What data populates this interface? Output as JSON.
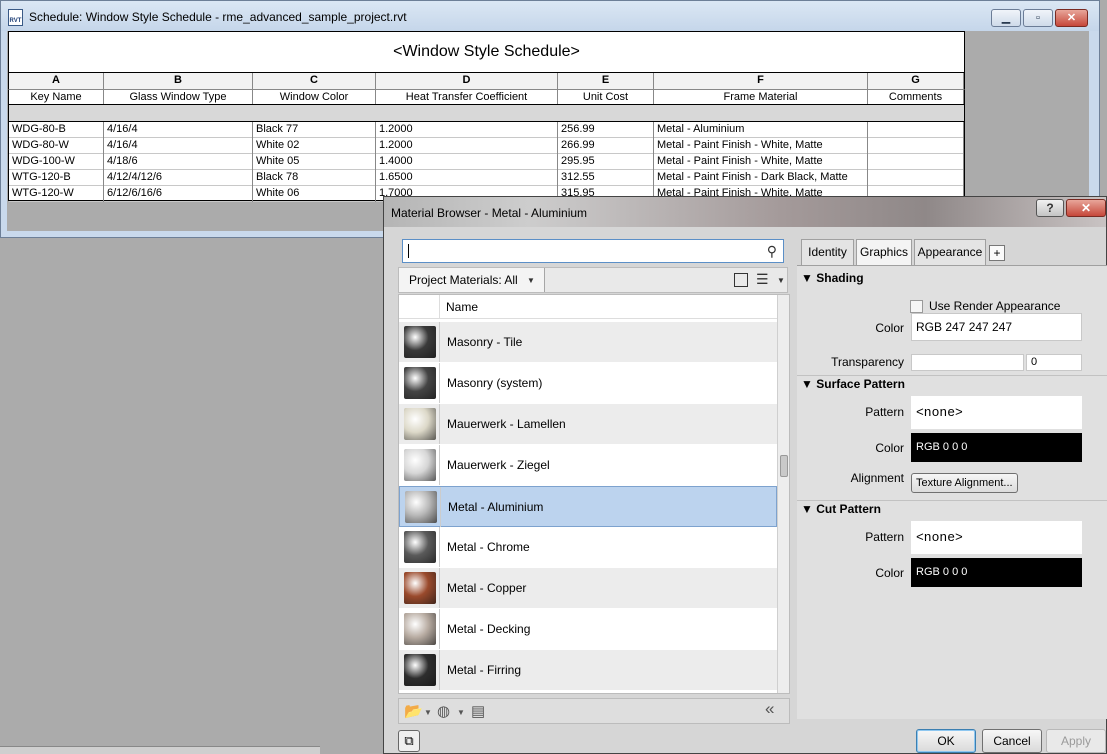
{
  "schedule_window": {
    "title": "Schedule: Window Style Schedule - rme_advanced_sample_project.rvt",
    "app_icon_text": "RVT",
    "heading": "<Window Style Schedule>",
    "column_letters": [
      "A",
      "B",
      "C",
      "D",
      "E",
      "F",
      "G"
    ],
    "column_headers": [
      "Key Name",
      "Glass Window Type",
      "Window Color",
      "Heat Transfer Coefficient",
      "Unit Cost",
      "Frame Material",
      "Comments"
    ],
    "rows": [
      [
        "WDG-80-B",
        "4/16/4",
        "Black 77",
        "1.2000",
        "256.99",
        "Metal - Aluminium",
        ""
      ],
      [
        "WDG-80-W",
        "4/16/4",
        "White 02",
        "1.2000",
        "266.99",
        "Metal - Paint Finish - White, Matte",
        ""
      ],
      [
        "WDG-100-W",
        "4/18/6",
        "White 05",
        "1.4000",
        "295.95",
        "Metal - Paint Finish - White, Matte",
        ""
      ],
      [
        "WTG-120-B",
        "4/12/4/12/6",
        "Black 78",
        "1.6500",
        "312.55",
        "Metal - Paint Finish - Dark Black, Matte",
        ""
      ],
      [
        "WTG-120-W",
        "6/12/6/16/6",
        "White 06",
        "1.7000",
        "315.95",
        "Metal - Paint Finish - White, Matte",
        ""
      ]
    ]
  },
  "material_browser": {
    "title": "Material Browser - Metal - Aluminium",
    "search": {
      "value": "",
      "placeholder": ""
    },
    "filter_label": "Project Materials: All",
    "list_header": "Name",
    "materials": [
      {
        "name": "Masonry - Tile",
        "color": "#3a3a3a",
        "selected": false
      },
      {
        "name": "Masonry (system)",
        "color": "#444444",
        "selected": false
      },
      {
        "name": "Mauerwerk - Lamellen",
        "color": "#dcd8c8",
        "selected": false
      },
      {
        "name": "Mauerwerk - Ziegel",
        "color": "#d6d6d6",
        "selected": false
      },
      {
        "name": "Metal - Aluminium",
        "color": "#b9b9b9",
        "selected": true
      },
      {
        "name": "Metal - Chrome",
        "color": "#5a5a5a",
        "selected": false
      },
      {
        "name": "Metal - Copper",
        "color": "#9a4a2c",
        "selected": false
      },
      {
        "name": "Metal - Decking",
        "color": "#b8aca2",
        "selected": false
      },
      {
        "name": "Metal - Firring",
        "color": "#2e2e2e",
        "selected": false
      }
    ],
    "tabs": [
      {
        "label": "Identity",
        "active": false
      },
      {
        "label": "Graphics",
        "active": true
      },
      {
        "label": "Appearance",
        "active": false
      }
    ],
    "tab_add_label": "+",
    "shading": {
      "heading": "Shading",
      "use_render_appearance_label": "Use Render Appearance",
      "use_render_appearance_checked": false,
      "color_label": "Color",
      "color_value": "RGB 247 247 247",
      "transparency_label": "Transparency",
      "transparency_value": "0"
    },
    "surface_pattern": {
      "heading": "Surface Pattern",
      "pattern_label": "Pattern",
      "pattern_value": "<none>",
      "color_label": "Color",
      "color_value": "RGB 0 0 0",
      "alignment_label": "Alignment",
      "alignment_button": "Texture Alignment..."
    },
    "cut_pattern": {
      "heading": "Cut Pattern",
      "pattern_label": "Pattern",
      "pattern_value": "<none>",
      "color_label": "Color",
      "color_value": "RGB 0 0 0"
    },
    "buttons": {
      "ok": "OK",
      "cancel": "Cancel",
      "apply": "Apply"
    },
    "help_label": "?",
    "collapse_label": "«"
  },
  "colors": {
    "selection_bg": "#bcd3ee",
    "selection_border": "#7da2ce",
    "row_alt": "#ececec"
  }
}
